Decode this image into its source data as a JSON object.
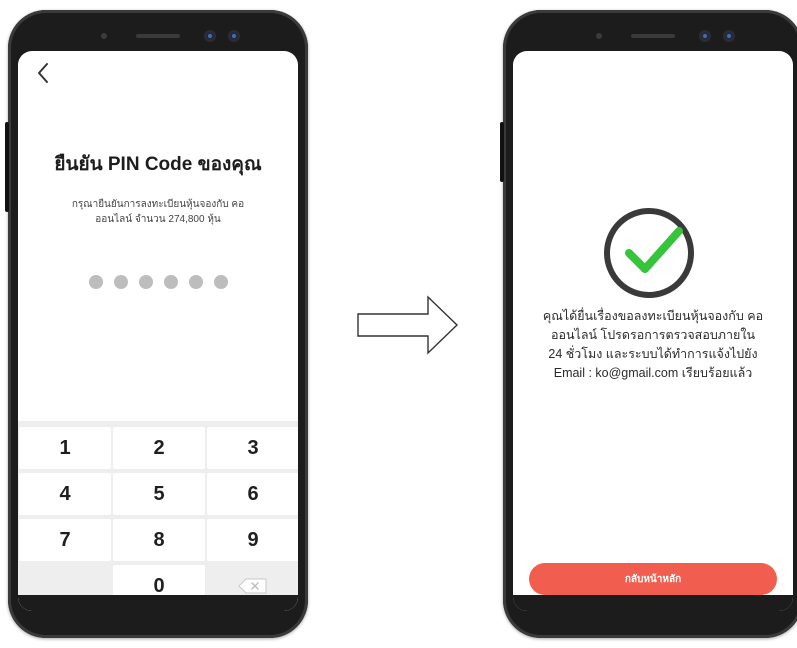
{
  "pin_screen": {
    "title": "ยืนยัน PIN Code ของคุณ",
    "description": "กรุณายืนยันการลงทะเบียนหุ้นจองกับ คอ ออนไลน์ จำนวน 274,800 หุ้น",
    "pin_length": 6,
    "keys": {
      "k1": "1",
      "k2": "2",
      "k3": "3",
      "k4": "4",
      "k5": "5",
      "k6": "6",
      "k7": "7",
      "k8": "8",
      "k9": "9",
      "k0": "0"
    }
  },
  "success_screen": {
    "line1": "คุณได้ยื่นเรื่องขอลงทะเบียนหุ้นจองกับ คอ",
    "line2": "ออนไลน์ โปรดรอการตรวจสอบภายใน",
    "line3": "24 ชั่วโมง และระบบได้ทำการแจ้งไปยัง",
    "line4": "Email : ko@gmail.com เรียบร้อยแล้ว",
    "button_label": "กลับหน้าหลัก"
  },
  "colors": {
    "accent": "#f15e4f",
    "check_green": "#36c43b",
    "ring": "#3a3a3a",
    "pin_dot": "#bdbdbd"
  },
  "icons": {
    "back": "chevron-left-icon",
    "delete": "backspace-icon",
    "success": "check-circle-icon",
    "flow": "right-arrow-icon"
  }
}
